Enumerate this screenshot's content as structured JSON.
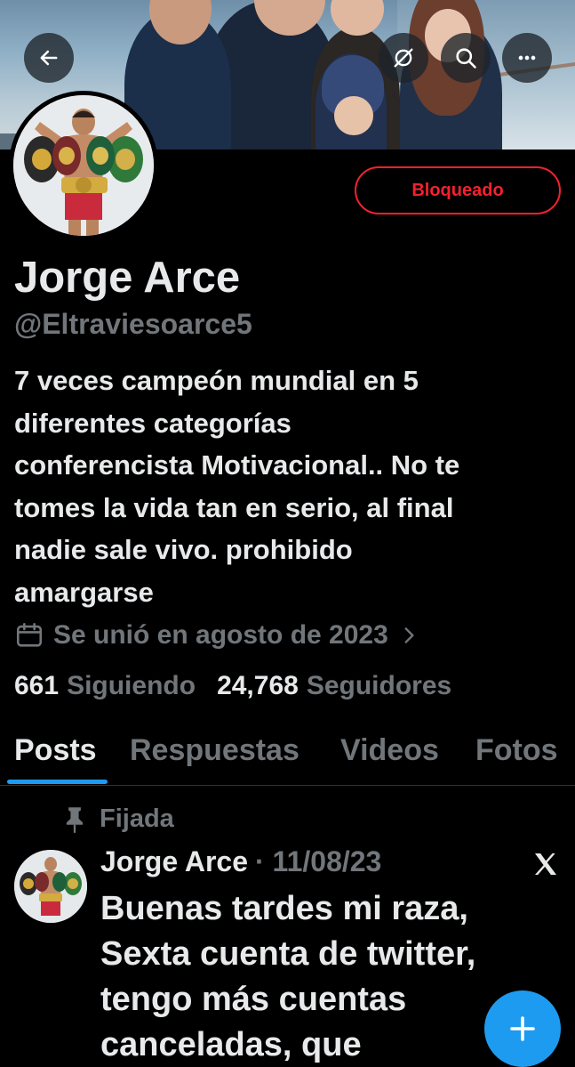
{
  "banner": {
    "back_icon": "arrow-left-icon",
    "grok_icon": "grok-icon",
    "search_icon": "search-icon",
    "more_icon": "more-horizontal-icon"
  },
  "profile": {
    "name": "Jorge Arce",
    "handle": "@Eltraviesoarce5",
    "blocked_label": "Bloqueado",
    "bio_lines": [
      "7 veces campeón mundial en 5",
      "diferentes categorías",
      "conferencista Motivacional.. No te",
      "tomes la vida tan en serio, al final",
      "nadie sale vivo. prohibido",
      "amargarse"
    ],
    "joined": "Se unió en agosto de 2023",
    "following_count": "661",
    "following_label": "Siguiendo",
    "followers_count": "24,768",
    "followers_label": "Seguidores"
  },
  "tabs": [
    {
      "label": "Posts",
      "active": true
    },
    {
      "label": "Respuestas",
      "active": false
    },
    {
      "label": "Videos",
      "active": false
    },
    {
      "label": "Fotos",
      "active": false
    }
  ],
  "pinned_post": {
    "pinned_label": "Fijada",
    "author": "Jorge Arce",
    "date": "· 11/08/23",
    "text_lines": [
      "Buenas tardes mi raza,",
      "Sexta cuenta de twitter,",
      "tengo más cuentas",
      "canceladas, que"
    ]
  },
  "colors": {
    "background": "#000000",
    "text_primary": "#e7e9ea",
    "text_secondary": "#71767b",
    "accent": "#1d9bf0",
    "blocked": "#f4212e"
  }
}
